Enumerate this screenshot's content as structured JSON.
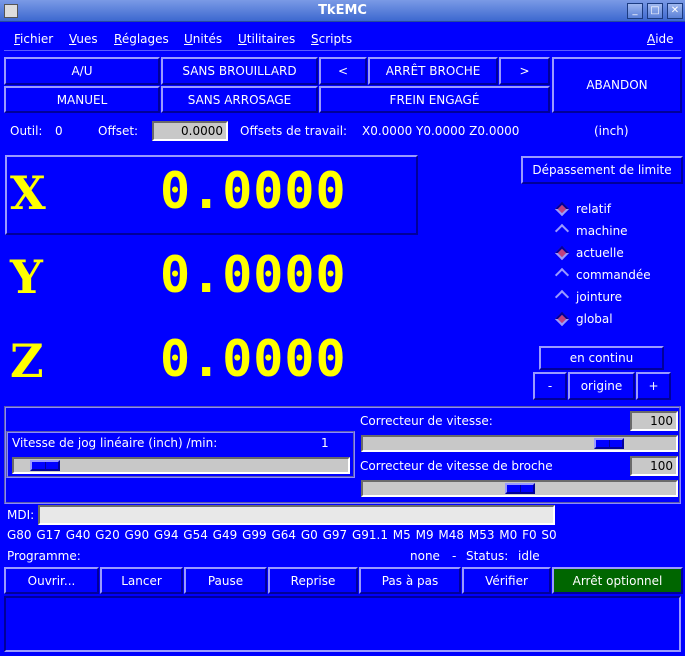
{
  "window": {
    "title": "TkEMC",
    "min_glyph": "_",
    "max_glyph": "□",
    "close_glyph": "✕"
  },
  "menu": {
    "fichier": {
      "u": "F",
      "rest": "ichier"
    },
    "vues": {
      "u": "V",
      "rest": "ues"
    },
    "reglages": {
      "u": "R",
      "rest": "églages"
    },
    "unites": {
      "u": "U",
      "rest": "nités"
    },
    "utilitaires": {
      "u": "U",
      "rest": "tilitaires"
    },
    "scripts": {
      "u": "S",
      "rest": "cripts"
    },
    "aide": {
      "u": "A",
      "rest": "ide"
    }
  },
  "status_buttons": {
    "estop": "A/U",
    "mist": "SANS BROUILLARD",
    "spindle_dec": "<",
    "spindle": "ARRÊT BROCHE",
    "spindle_inc": ">",
    "abort": "ABANDON",
    "mode": "MANUEL",
    "flood": "SANS ARROSAGE",
    "brake": "FREIN ENGAGÉ"
  },
  "tool_line": {
    "tool_label": "Outil:",
    "tool_value": "0",
    "offset_label": "Offset:",
    "offset_value": "0.0000",
    "work_offsets_label": "Offsets de travail:",
    "work_offsets_value": "X0.0000 Y0.0000 Z0.0000",
    "units": "(inch)"
  },
  "dro": {
    "x": {
      "axis": "X",
      "value": "0.0000"
    },
    "y": {
      "axis": "Y",
      "value": "0.0000"
    },
    "z": {
      "axis": "Z",
      "value": "0.0000"
    }
  },
  "limit_override": "Dépassement de limite",
  "coords": {
    "relatif": "relatif",
    "machine": "machine",
    "actuelle": "actuelle",
    "commandee": "commandée",
    "jointure": "jointure",
    "global": "global"
  },
  "jog": {
    "mode": "en continu",
    "minus": "-",
    "home": "origine",
    "plus": "+",
    "speed_label": "Vitesse de jog linéaire   (inch)  /min:",
    "speed_value": "1",
    "slider_fraction": 0.05
  },
  "feed_override": {
    "label": "Correcteur de vitesse:",
    "value": "100",
    "slider_fraction": 0.82
  },
  "spindle_override": {
    "label": "Correcteur de vitesse de broche",
    "value": "100",
    "slider_fraction": 0.5
  },
  "mdi": {
    "label": "MDI:",
    "value": ""
  },
  "active_codes": "G80 G17 G40 G20 G90 G94 G54 G49 G99 G64 G0 G97 G91.1 M5 M9 M48 M53 M0 F0 S0",
  "program": {
    "label": "Programme:",
    "name": "none",
    "sep": "-",
    "status_label": "Status:",
    "status": "idle"
  },
  "program_buttons": {
    "open": "Ouvrir...",
    "run": "Lancer",
    "pause": "Pause",
    "resume": "Reprise",
    "step": "Pas à pas",
    "verify": "Vérifier",
    "optional_stop": "Arrêt optionnel"
  },
  "colors": {
    "background": "#0000ff",
    "dro_text": "#ffff00",
    "optional_stop_bg": "#006600"
  }
}
